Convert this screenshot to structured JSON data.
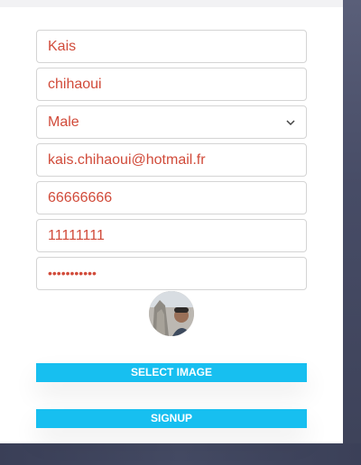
{
  "form": {
    "first_name": "Kais",
    "last_name": "chihaoui",
    "gender": "Male",
    "email": "kais.chihaoui@hotmail.fr",
    "phone": "66666666",
    "cin": "11111111",
    "password_mask": "•••••••••••"
  },
  "buttons": {
    "select_image": "SELECT IMAGE",
    "signup": "SIGNUP"
  },
  "colors": {
    "accent": "#17bff0",
    "field_text": "#d14b3a",
    "background": "#3c4159"
  },
  "icons": {
    "select_chevron": "chevron-down-icon"
  }
}
